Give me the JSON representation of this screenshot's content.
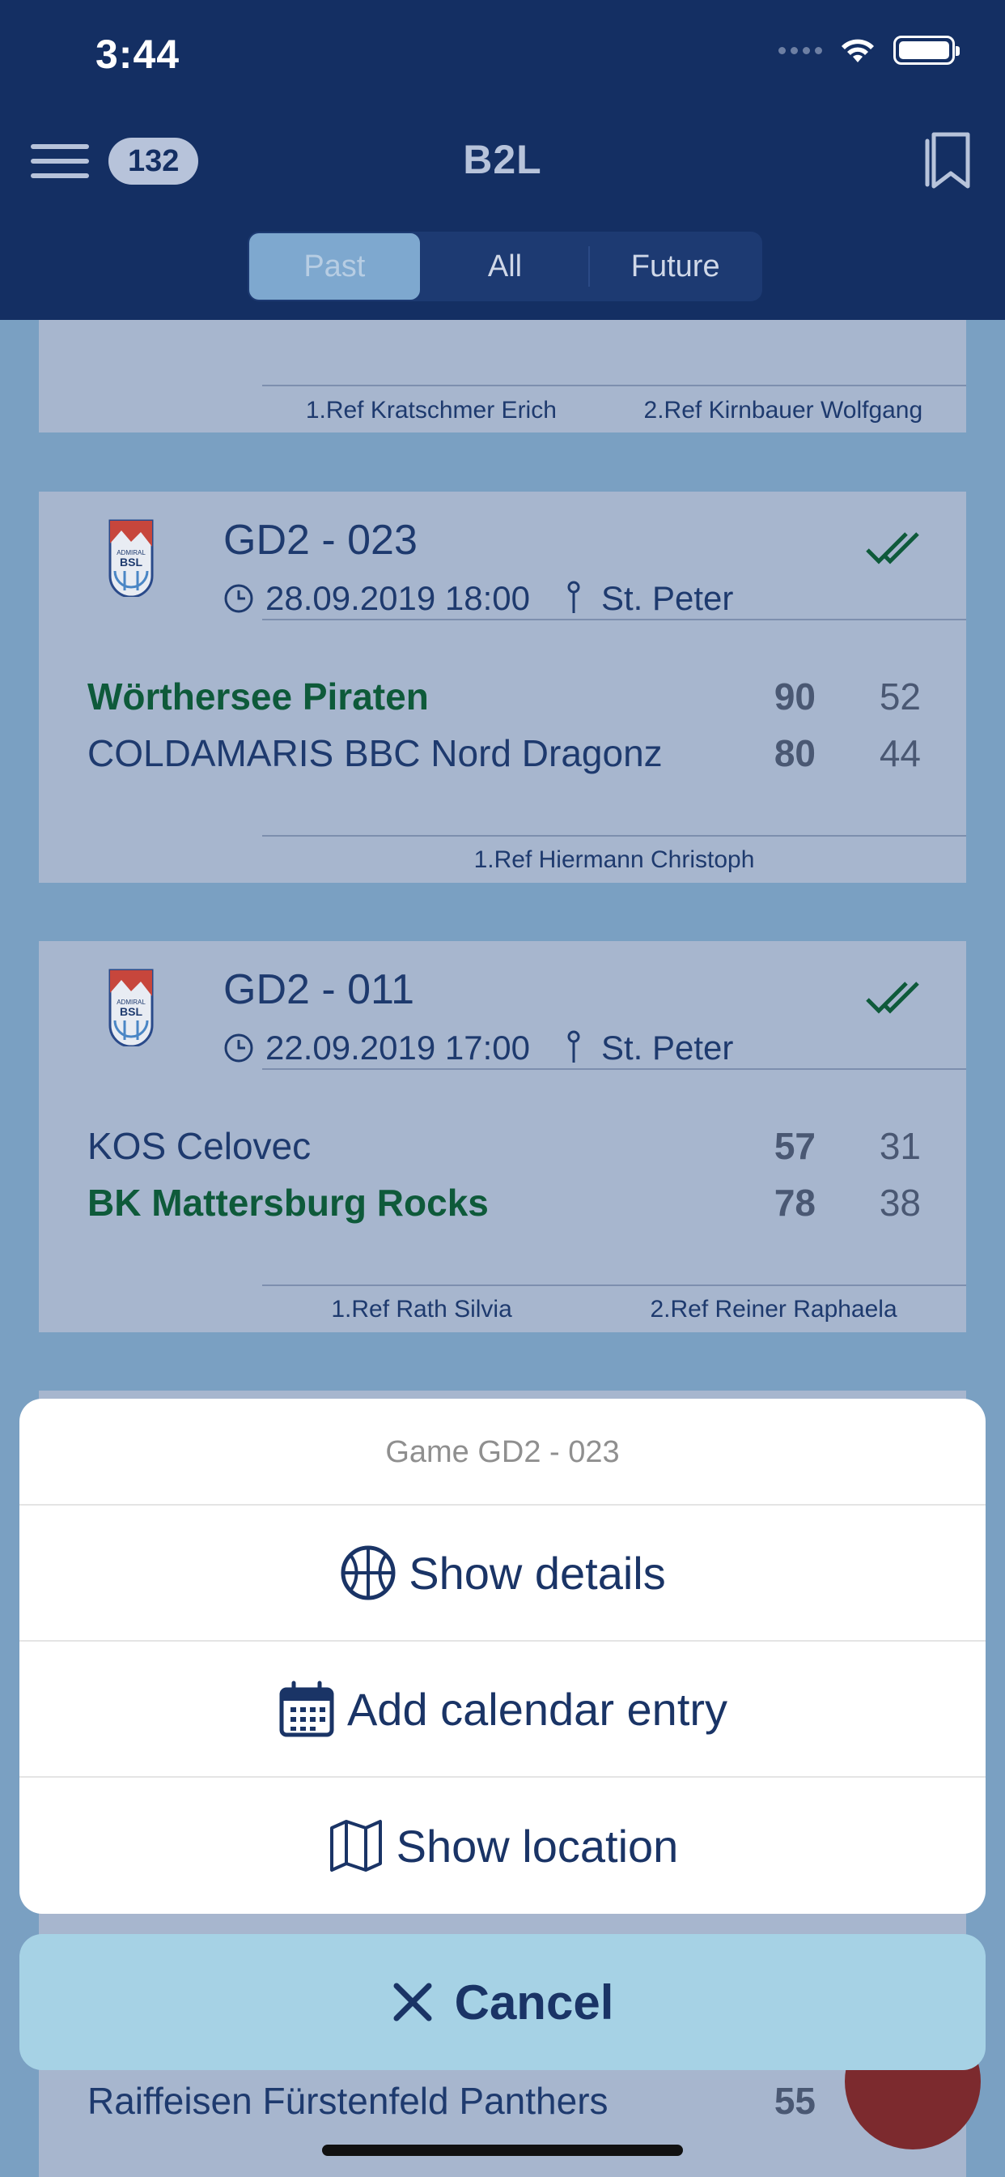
{
  "status_bar": {
    "time": "3:44"
  },
  "nav": {
    "badge_count": "132",
    "title": "B2L"
  },
  "tabs": [
    {
      "label": "Past",
      "active": true
    },
    {
      "label": "All",
      "active": false
    },
    {
      "label": "Future",
      "active": false
    }
  ],
  "games": [
    {
      "refs": [
        "1.Ref Kratschmer Erich",
        "2.Ref Kirnbauer Wolfgang"
      ]
    },
    {
      "code": "GD2 - 023",
      "datetime": "28.09.2019 18:00",
      "location": "St. Peter",
      "teams": [
        {
          "name": "Wörthersee Piraten",
          "score": "90",
          "half": "52",
          "winner": true
        },
        {
          "name": "COLDAMARIS BBC Nord Dragonz",
          "score": "80",
          "half": "44",
          "winner": false
        }
      ],
      "refs": [
        "1.Ref Hiermann Christoph"
      ]
    },
    {
      "code": "GD2 - 011",
      "datetime": "22.09.2019 17:00",
      "location": "St. Peter",
      "teams": [
        {
          "name": "KOS Celovec",
          "score": "57",
          "half": "31",
          "winner": false
        },
        {
          "name": "BK Mattersburg Rocks",
          "score": "78",
          "half": "38",
          "winner": true
        }
      ],
      "refs": [
        "1.Ref Rath Silvia",
        "2.Ref Reiner Raphaela"
      ]
    },
    {
      "teams": [
        {
          "name": "Raiffeisen Fürstenfeld Panthers",
          "score": "55"
        }
      ]
    }
  ],
  "logo": {
    "line1": "ADMIRAL",
    "line2": "BSL"
  },
  "action_sheet": {
    "title": "Game GD2 - 023",
    "items": [
      {
        "label": "Show details",
        "icon": "basketball-icon"
      },
      {
        "label": "Add calendar entry",
        "icon": "calendar-icon"
      },
      {
        "label": "Show location",
        "icon": "map-icon"
      }
    ],
    "cancel_label": "Cancel"
  },
  "colors": {
    "nav_bg": "#142f63",
    "winner": "#0e5a3a",
    "cancel_bg": "#a6d2e5",
    "fab": "#7c2a2e"
  }
}
